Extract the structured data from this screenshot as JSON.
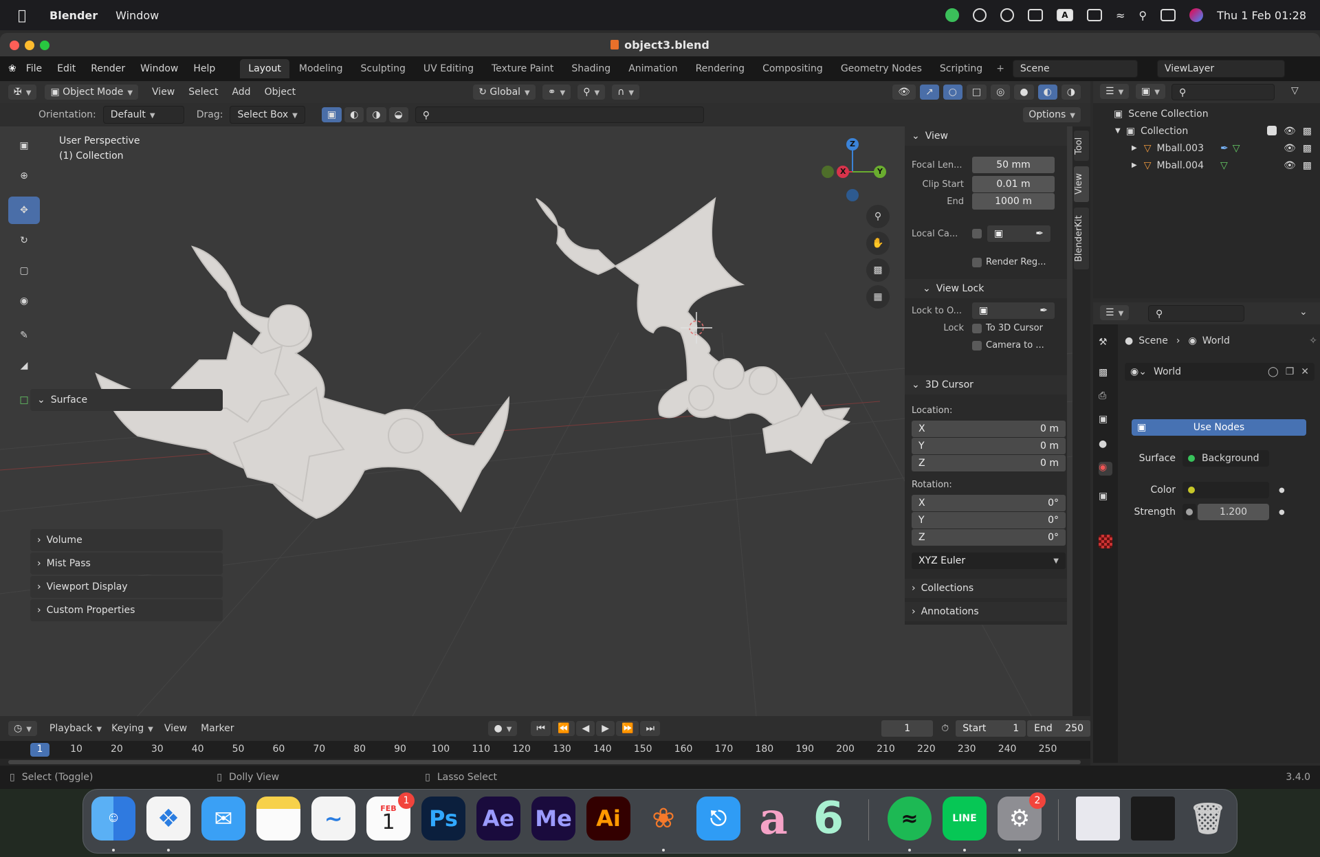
{
  "macmenu": {
    "app": "Blender",
    "items": [
      "Window"
    ],
    "clock": "Thu 1 Feb  01:28",
    "input_badge": "A"
  },
  "window": {
    "title": "object3.blend"
  },
  "blender_menu": {
    "items": [
      "File",
      "Edit",
      "Render",
      "Window",
      "Help"
    ],
    "workspaces": [
      "Layout",
      "Modeling",
      "Sculpting",
      "UV Editing",
      "Texture Paint",
      "Shading",
      "Animation",
      "Rendering",
      "Compositing",
      "Geometry Nodes",
      "Scripting"
    ],
    "scene": "Scene",
    "view_layer": "ViewLayer"
  },
  "viewport_header": {
    "mode": "Object Mode",
    "menus": [
      "View",
      "Select",
      "Add",
      "Object"
    ],
    "transform": "Global"
  },
  "viewport_tool": {
    "orientation_label": "Orientation:",
    "orientation": "Default",
    "drag_label": "Drag:",
    "drag": "Select Box",
    "options": "Options"
  },
  "viewport": {
    "perspective": "User Perspective",
    "collection": "(1) Collection",
    "axis_x": "X",
    "axis_y": "Y",
    "axis_z": "Z"
  },
  "npanel": {
    "view_title": "View",
    "focal_label": "Focal Len...",
    "focal": "50 mm",
    "clip_start_label": "Clip Start",
    "clip_start": "0.01 m",
    "end_label": "End",
    "end": "1000 m",
    "local_cam": "Local Ca...",
    "render_region": "Render Reg...",
    "view_lock": "View Lock",
    "lock_to": "Lock to O...",
    "lock_label": "Lock",
    "to_cursor": "To 3D Cursor",
    "camera_to": "Camera to ...",
    "cursor_title": "3D Cursor",
    "location": "Location:",
    "loc": [
      {
        "k": "X",
        "v": "0 m"
      },
      {
        "k": "Y",
        "v": "0 m"
      },
      {
        "k": "Z",
        "v": "0 m"
      }
    ],
    "rotation": "Rotation:",
    "rot": [
      {
        "k": "X",
        "v": "0°"
      },
      {
        "k": "Y",
        "v": "0°"
      },
      {
        "k": "Z",
        "v": "0°"
      }
    ],
    "euler": "XYZ Euler",
    "collections": "Collections",
    "annotations": "Annotations",
    "tabs": [
      "Tool",
      "View",
      "BlenderKit"
    ]
  },
  "outliner": {
    "scene_collection": "Scene Collection",
    "collection": "Collection",
    "objects": [
      "Mball.003",
      "Mball.004"
    ]
  },
  "properties": {
    "scene": "Scene",
    "world": "World",
    "world_field": "World",
    "surface_section": "Surface",
    "use_nodes": "Use Nodes",
    "surface_label": "Surface",
    "surface_value": "Background",
    "color_label": "Color",
    "strength_label": "Strength",
    "strength": "1.200",
    "sections": [
      "Volume",
      "Mist Pass",
      "Viewport Display",
      "Custom Properties"
    ]
  },
  "timeline": {
    "menus": [
      "Playback",
      "Keying",
      "View",
      "Marker"
    ],
    "current": "1",
    "start_label": "Start",
    "start": "1",
    "end_label": "End",
    "end": "250",
    "ticks": [
      "1",
      "10",
      "20",
      "30",
      "40",
      "50",
      "60",
      "70",
      "80",
      "90",
      "100",
      "110",
      "120",
      "130",
      "140",
      "150",
      "160",
      "170",
      "180",
      "190",
      "200",
      "210",
      "220",
      "230",
      "240",
      "250"
    ]
  },
  "status": {
    "left": "Select (Toggle)",
    "mid": "Dolly View",
    "right": "Lasso Select",
    "version": "3.4.0"
  },
  "dock": {
    "calendar_month": "FEB",
    "calendar_day": "1",
    "calendar_badge": "1",
    "settings_badge": "2",
    "ps": "Ps",
    "ae": "Ae",
    "me": "Me",
    "ai": "Ai",
    "line": "LINE",
    "a": "a",
    "six": "6"
  }
}
